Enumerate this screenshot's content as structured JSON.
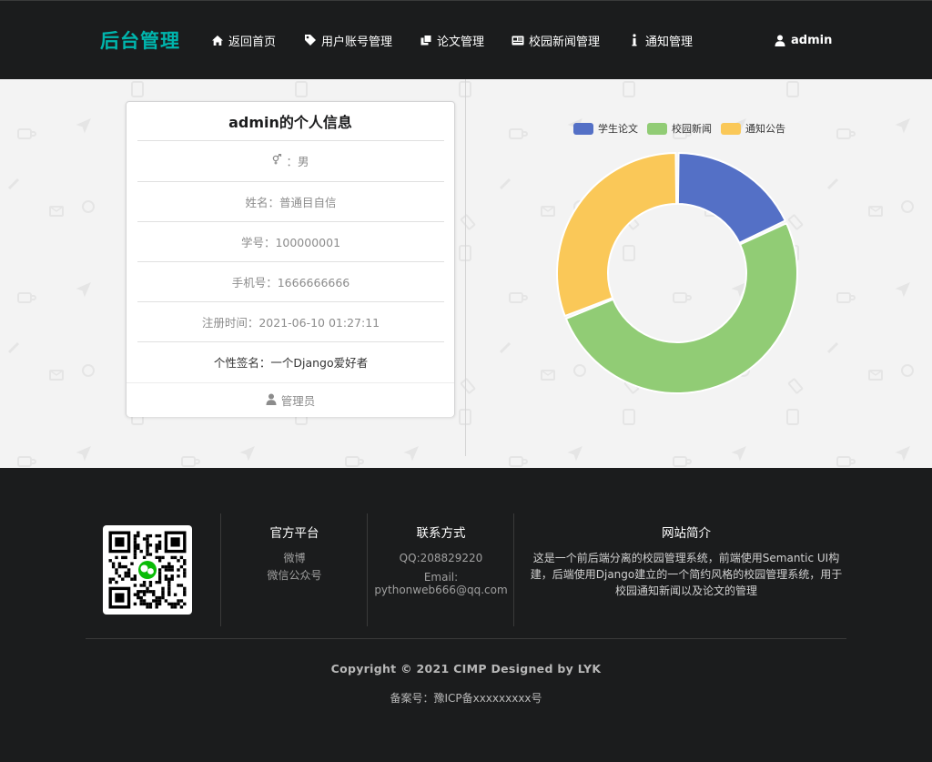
{
  "header": {
    "brand": "后台管理",
    "nav": [
      {
        "label": "返回首页",
        "icon": "home-icon"
      },
      {
        "label": "用户账号管理",
        "icon": "tag-icon"
      },
      {
        "label": "论文管理",
        "icon": "clone-icon"
      },
      {
        "label": "校园新闻管理",
        "icon": "newspaper-icon"
      },
      {
        "label": "通知管理",
        "icon": "info-icon"
      }
    ],
    "user": {
      "label": "admin",
      "icon": "user-icon"
    }
  },
  "profile": {
    "title": "admin的个人信息",
    "gender_label": "：男",
    "name": "姓名：普通目自信",
    "student_id": "学号：100000001",
    "phone": "手机号：1666666666",
    "register_time": "注册时间：2021-06-10 01:27:11",
    "signature": "个性签名：一个Django爱好者",
    "role": "管理员"
  },
  "chart_data": {
    "type": "pie",
    "donut": true,
    "legend_position": "top",
    "series": [
      {
        "name": "学生论文",
        "value": 18,
        "color": "#5470c6"
      },
      {
        "name": "校园新闻",
        "value": 51,
        "color": "#91cc75"
      },
      {
        "name": "通知公告",
        "value": 31,
        "color": "#fac858"
      }
    ]
  },
  "footer": {
    "platform": {
      "title": "官方平台",
      "links": [
        "微博",
        "微信公众号"
      ]
    },
    "contact": {
      "title": "联系方式",
      "qq": "QQ:208829220",
      "email_label": "Email:",
      "email": "pythonweb666@qq.com"
    },
    "about": {
      "title": "网站简介",
      "text": "这是一个前后端分离的校园管理系统，前端使用Semantic UI构建，后端使用Django建立的一个简约风格的校园管理系统，用于校园通知新闻以及论文的管理"
    },
    "copyright": "Copyright © 2021 CIMP Designed by LYK",
    "icp": "备案号：豫ICP备xxxxxxxxx号"
  },
  "colors": {
    "brand": "#00b5ad",
    "dark_bg": "#1b1c1d",
    "main_bg": "#f3f3f3"
  }
}
